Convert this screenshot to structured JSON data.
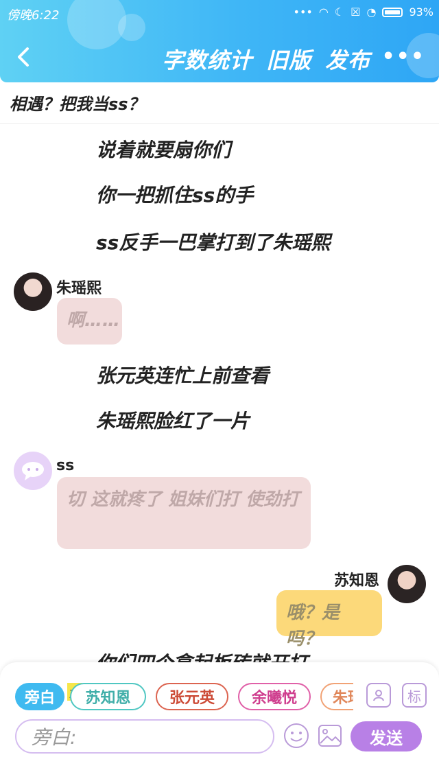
{
  "status_bar": {
    "time": "傍晚6:22",
    "battery": "93%"
  },
  "nav": {
    "actions": [
      "字数统计",
      "旧版",
      "发布"
    ]
  },
  "story_title": "相遇？把我当ss？",
  "messages": {
    "n1": "说着就要扇你们",
    "n2": "你一把抓住ss的手",
    "n3": "ss反手一巴掌打到了朱瑶熙",
    "zhu_name": "朱瑶熙",
    "zhu_text": "啊……",
    "n4": "张元英连忙上前查看",
    "n5": "朱瑶熙脸红了一片",
    "ss_name": "ss",
    "ss_text": "切  这就疼了  姐妹们打  使劲打",
    "su_name": "苏知恩",
    "su_text": "哦？是吗？",
    "n6": "你们四个拿起板砖就开打"
  },
  "bottom_panel": {
    "chips": [
      "旁白",
      "苏知恩",
      "张元英",
      "余曦悦",
      "朱瑶"
    ],
    "main_tag": "主",
    "label_icon": "标",
    "input_placeholder": "旁白:",
    "send_label": "发送"
  },
  "colors": {
    "header": "#3fb6f6",
    "left_bubble": "#f2dcdc",
    "right_bubble": "#fcd97a",
    "send": "#b880e6"
  }
}
